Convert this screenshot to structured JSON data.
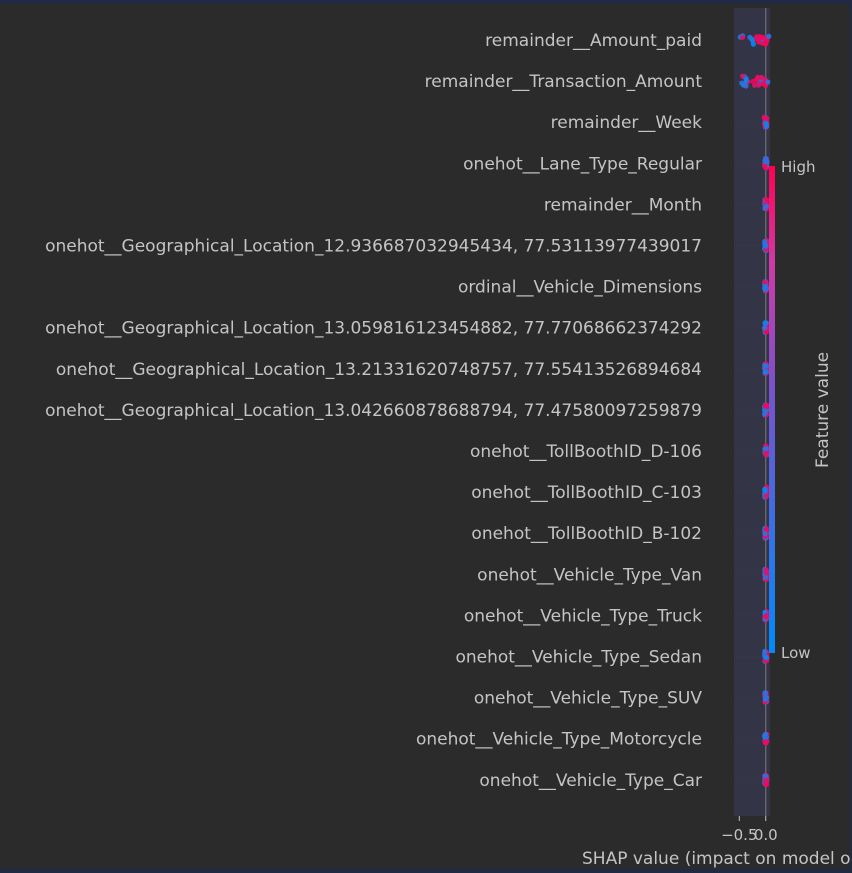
{
  "chart_data": {
    "type": "scatter",
    "subtype": "shap-beeswarm",
    "title": "",
    "xlabel": "SHAP value (impact on model output)",
    "x_tick_labels": [
      "−0.5",
      "0.0"
    ],
    "x_ticks": [
      -0.5,
      0.0
    ],
    "xlim": [
      -0.6,
      0.08
    ],
    "features": [
      {
        "name": "remainder__Amount_paid",
        "shap_min": -0.48,
        "shap_max": 0.06
      },
      {
        "name": "remainder__Transaction_Amount",
        "shap_min": -0.48,
        "shap_max": 0.06
      },
      {
        "name": "remainder__Week",
        "shap_min": -0.03,
        "shap_max": 0.02
      },
      {
        "name": "onehot__Lane_Type_Regular",
        "shap_min": -0.02,
        "shap_max": 0.02
      },
      {
        "name": "remainder__Month",
        "shap_min": -0.02,
        "shap_max": 0.02
      },
      {
        "name": "onehot__Geographical_Location_12.936687032945434, 77.53113977439017",
        "shap_min": -0.02,
        "shap_max": 0.02
      },
      {
        "name": "ordinal__Vehicle_Dimensions",
        "shap_min": -0.02,
        "shap_max": 0.02
      },
      {
        "name": "onehot__Geographical_Location_13.059816123454882, 77.77068662374292",
        "shap_min": -0.02,
        "shap_max": 0.02
      },
      {
        "name": "onehot__Geographical_Location_13.21331620748757, 77.55413526894684",
        "shap_min": -0.02,
        "shap_max": 0.02
      },
      {
        "name": "onehot__Geographical_Location_13.042660878688794, 77.47580097259879",
        "shap_min": -0.02,
        "shap_max": 0.02
      },
      {
        "name": "onehot__TollBoothID_D-106",
        "shap_min": -0.02,
        "shap_max": 0.02
      },
      {
        "name": "onehot__TollBoothID_C-103",
        "shap_min": -0.02,
        "shap_max": 0.02
      },
      {
        "name": "onehot__TollBoothID_B-102",
        "shap_min": -0.02,
        "shap_max": 0.02
      },
      {
        "name": "onehot__Vehicle_Type_Van",
        "shap_min": -0.02,
        "shap_max": 0.02
      },
      {
        "name": "onehot__Vehicle_Type_Truck",
        "shap_min": -0.02,
        "shap_max": 0.02
      },
      {
        "name": "onehot__Vehicle_Type_Sedan",
        "shap_min": -0.02,
        "shap_max": 0.02
      },
      {
        "name": "onehot__Vehicle_Type_SUV",
        "shap_min": -0.02,
        "shap_max": 0.02
      },
      {
        "name": "onehot__Vehicle_Type_Motorcycle",
        "shap_min": -0.02,
        "shap_max": 0.02
      },
      {
        "name": "onehot__Vehicle_Type_Car",
        "shap_min": -0.02,
        "shap_max": 0.02
      }
    ],
    "colorbar": {
      "label": "Feature value",
      "high_label": "High",
      "low_label": "Low",
      "high_color": "#ff0052",
      "low_color": "#008bfb"
    }
  },
  "colors": {
    "background": "#2b2b2b",
    "plot_area": "#343447",
    "text": "#c4c4c4",
    "zero_line": "#7a7a7a",
    "frame": "#1f2a44"
  }
}
